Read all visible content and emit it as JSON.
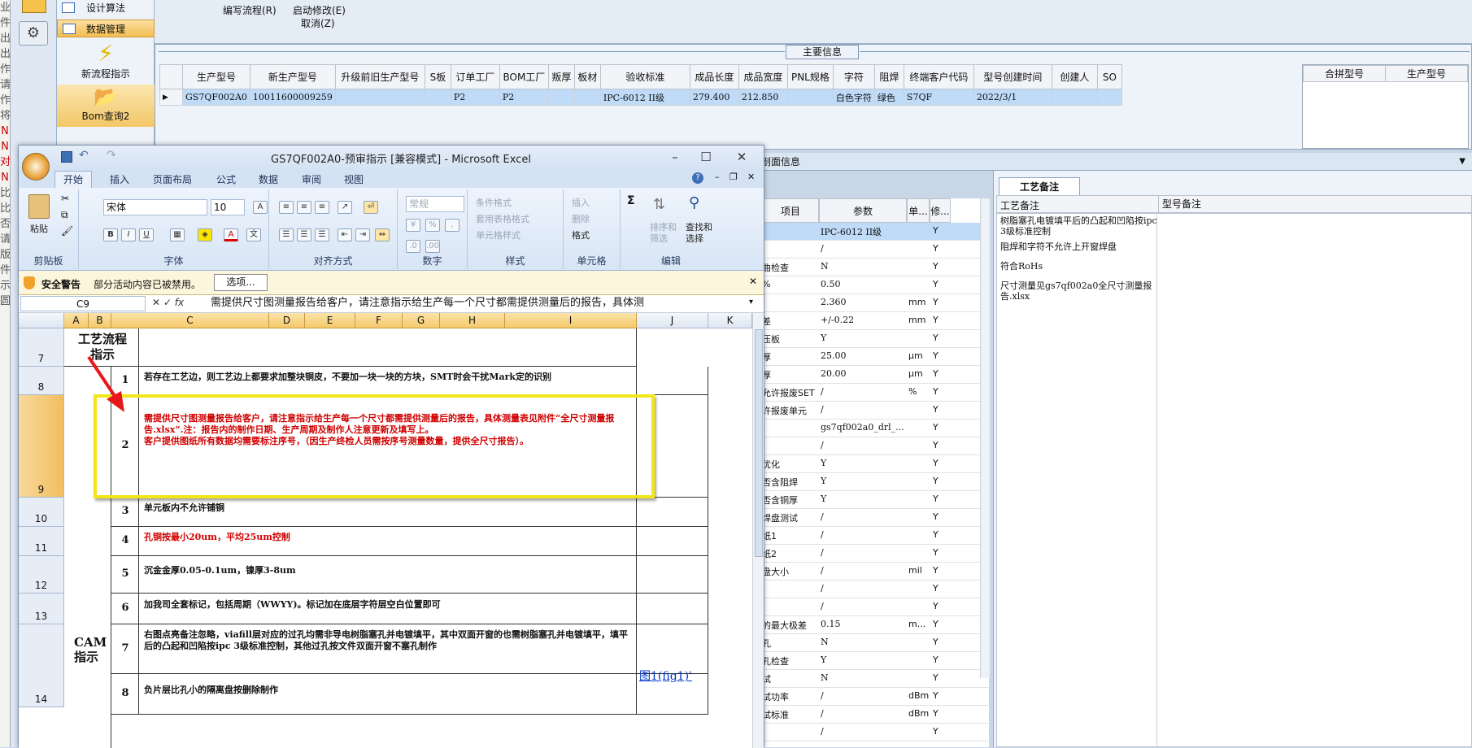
{
  "left_edge_chars": [
    "业",
    "件",
    "出",
    "出",
    "作",
    "请",
    "作",
    "将",
    "N",
    "N",
    "对",
    "N",
    "比",
    "比",
    "否",
    "请",
    "版",
    "件",
    "示",
    "圆"
  ],
  "nav": {
    "items": [
      {
        "label": "设计算法"
      },
      {
        "label": "数据管理"
      },
      {
        "label": "新流程指示"
      },
      {
        "label": "Bom查询2"
      }
    ]
  },
  "toolbar": {
    "items": [
      "编写流程(R)",
      "启动修改(E)",
      "取消(Z)"
    ]
  },
  "main_info": {
    "title": "主要信息",
    "columns": [
      "生产型号",
      "新生产型号",
      "升级前旧生产型号",
      "S板",
      "订单工厂",
      "BOM工厂",
      "叛厚",
      "板材",
      "验收标准",
      "成品长度",
      "成品宽度",
      "PNL规格",
      "字符",
      "阻焊",
      "终端客户代码",
      "型号创建时间",
      "创建人",
      "SO"
    ],
    "row": [
      "GS7QF002A0",
      "10011600009259",
      "",
      "",
      "P2",
      "P2",
      "",
      "",
      "IPC-6012 II级",
      "279.400",
      "212.850",
      "",
      "白色字符",
      "绿色",
      "S7QF",
      "2022/3/1",
      "",
      ""
    ],
    "merge_columns": [
      "合拼型号",
      "生产型号"
    ]
  },
  "process_bar": {
    "label": "剖面信息"
  },
  "params": {
    "columns": [
      "项目",
      "参数",
      "单...",
      "修..."
    ],
    "rows": [
      {
        "name": "",
        "value": "IPC-6012 II级",
        "unit": "",
        "flag": "Y"
      },
      {
        "name": "",
        "value": "/",
        "unit": "",
        "flag": "Y"
      },
      {
        "name": "曲检查",
        "value": "N",
        "unit": "",
        "flag": "Y"
      },
      {
        "name": "%",
        "value": "0.50",
        "unit": "",
        "flag": "Y"
      },
      {
        "name": "",
        "value": "2.360",
        "unit": "mm",
        "flag": "Y"
      },
      {
        "name": "差",
        "value": "+/-0.22",
        "unit": "mm",
        "flag": "Y"
      },
      {
        "name": "压板",
        "value": "Y",
        "unit": "",
        "flag": "Y"
      },
      {
        "name": "厚",
        "value": "25.00",
        "unit": "μm",
        "flag": "Y"
      },
      {
        "name": "厚",
        "value": "20.00",
        "unit": "μm",
        "flag": "Y"
      },
      {
        "name": "允许报废SET",
        "value": "/",
        "unit": "%",
        "flag": "Y"
      },
      {
        "name": "许报废单元",
        "value": "/",
        "unit": "",
        "flag": "Y"
      },
      {
        "name": "",
        "value": "gs7qf002a0_drl_...",
        "unit": "",
        "flag": "Y"
      },
      {
        "name": "",
        "value": "/",
        "unit": "",
        "flag": "Y"
      },
      {
        "name": "优化",
        "value": "Y",
        "unit": "",
        "flag": "Y"
      },
      {
        "name": "否含阻焊",
        "value": "Y",
        "unit": "",
        "flag": "Y"
      },
      {
        "name": "否含铜厚",
        "value": "Y",
        "unit": "",
        "flag": "Y"
      },
      {
        "name": "焊盘测试",
        "value": "/",
        "unit": "",
        "flag": "Y"
      },
      {
        "name": "纸1",
        "value": "/",
        "unit": "",
        "flag": "Y"
      },
      {
        "name": "纸2",
        "value": "/",
        "unit": "",
        "flag": "Y"
      },
      {
        "name": "盘大小",
        "value": "/",
        "unit": "mil",
        "flag": "Y"
      },
      {
        "name": "",
        "value": "/",
        "unit": "",
        "flag": "Y"
      },
      {
        "name": "",
        "value": "/",
        "unit": "",
        "flag": "Y"
      },
      {
        "name": "的最大极差",
        "value": "0.15",
        "unit": "m...",
        "flag": "Y"
      },
      {
        "name": "孔",
        "value": "N",
        "unit": "",
        "flag": "Y"
      },
      {
        "name": "孔检查",
        "value": "Y",
        "unit": "",
        "flag": "Y"
      },
      {
        "name": "试",
        "value": "N",
        "unit": "",
        "flag": "Y"
      },
      {
        "name": "试功率",
        "value": "/",
        "unit": "dBm",
        "flag": "Y"
      },
      {
        "name": "试标准",
        "value": "/",
        "unit": "dBm",
        "flag": "Y"
      },
      {
        "name": "",
        "value": "/",
        "unit": "",
        "flag": "Y"
      }
    ]
  },
  "notes": {
    "tab": "工艺备注",
    "col1": "工艺备注",
    "col2": "型号备注",
    "items": [
      "树脂塞孔电镀填平后的凸起和凹陷按ipc 3级标准控制",
      "阻焊和字符不允许上开窗焊盘",
      "符合RoHs",
      "尺寸测量见gs7qf002a0全尺寸测量报告.xlsx"
    ]
  },
  "excel": {
    "title": "GS7QF002A0-预审指示 [兼容模式] - Microsoft Excel",
    "tabs": [
      "开始",
      "插入",
      "页面布局",
      "公式",
      "数据",
      "审阅",
      "视图"
    ],
    "ribbon": {
      "paste": "粘贴",
      "clipboard": "剪贴板",
      "font_name": "宋体",
      "font_size": "10",
      "font_group": "字体",
      "align_group": "对齐方式",
      "number_format": "常规",
      "number_group": "数字",
      "cond_format": "条件格式",
      "table_format": "套用表格格式",
      "cell_style": "单元格样式",
      "style_group": "样式",
      "insert": "插入",
      "delete": "删除",
      "format": "格式",
      "cells_group": "单元格",
      "sort": "排序和筛选",
      "find": "查找和选择",
      "edit_group": "编辑"
    },
    "security": {
      "label": "安全警告",
      "msg": "部分活动内容已被禁用。",
      "button": "选项..."
    },
    "name_box": "C9",
    "formula": "需提供尺寸图测量报告给客户，请注意指示给生产每一个尺寸都需提供测量后的报告，具体测",
    "columns": [
      "A",
      "B",
      "C",
      "D",
      "E",
      "F",
      "G",
      "H",
      "I",
      "J",
      "K"
    ],
    "row_numbers": [
      "7",
      "8",
      "9",
      "10",
      "11",
      "12",
      "13",
      "14"
    ],
    "header_label": "工艺流程指示",
    "cam_label": "CAM指示",
    "items": [
      {
        "num": "1",
        "text": "若存在工艺边，则工艺边上都要求加整块铜皮，不要加一块一块的方块，SMT时会干扰Mark定的识别",
        "red": false
      },
      {
        "num": "2",
        "text": "需提供尺寸图测量报告给客户，请注意指示给生产每一个尺寸都需提供测量后的报告，具体测量表见附件“全尺寸测量报告.xlsx”.注：报告内的制作日期、生产周期及制作人注意更新及填写上。\n客户提供图纸所有数据均需要标注序号，（因生产终检人员需按序号测量数量，提供全尺寸报告）。",
        "red": true
      },
      {
        "num": "3",
        "text": "单元板内不允许铺铜",
        "red": false
      },
      {
        "num": "4",
        "text": "孔铜按最小20um，平均25um控制",
        "red": true
      },
      {
        "num": "5",
        "text": "沉金金厚0.05-0.1um，镍厚3-8um",
        "red": false
      },
      {
        "num": "6",
        "text": "加我司全套标记，包括周期（WWYY)。标记加在底层字符层空白位置即可",
        "red": false
      },
      {
        "num": "7",
        "text": "右图点亮备注忽略，viafill层对应的过孔均需非导电树脂塞孔并电镀填平，其中双面开窗的也需树脂塞孔并电镀填平，填平后的凸起和凹陷按ipc 3级标准控制，其他过孔按文件双面开窗不塞孔制作",
        "red": false
      },
      {
        "num": "8",
        "text": "负片层比孔小的隔离盘按删除制作",
        "red": false
      }
    ],
    "link": "图1(fig1)'"
  }
}
